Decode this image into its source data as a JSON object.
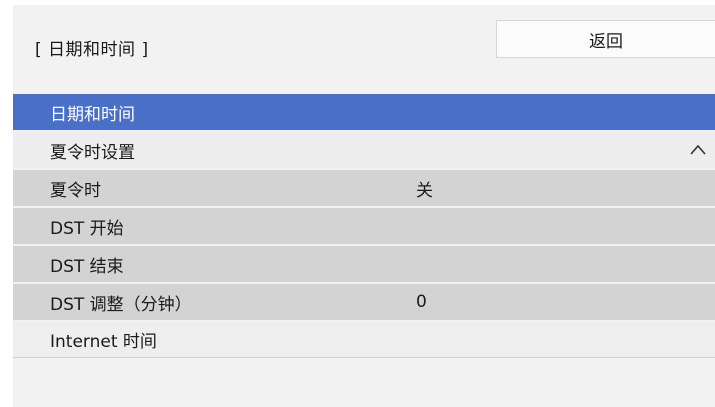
{
  "header": {
    "title": "[ 日期和时间 ]",
    "back_label": "返回"
  },
  "menu": {
    "items": [
      {
        "label": "日期和时间",
        "value": "",
        "state": "selected"
      },
      {
        "label": "夏令时设置",
        "value": "",
        "state": "section-expanded"
      },
      {
        "label": "夏令时",
        "value": "关",
        "state": "sub"
      },
      {
        "label": "DST 开始",
        "value": "",
        "state": "sub"
      },
      {
        "label": "DST 结束",
        "value": "",
        "state": "sub"
      },
      {
        "label": "DST 调整（分钟）",
        "value": "0",
        "state": "sub"
      },
      {
        "label": "Internet 时间",
        "value": "",
        "state": "normal"
      }
    ]
  },
  "colors": {
    "selected_bg": "#4a6fc6",
    "sub_bg": "#d3d3d3",
    "panel_bg": "#f2f2f2"
  },
  "icons": {
    "collapse": "chevron-up-icon"
  }
}
